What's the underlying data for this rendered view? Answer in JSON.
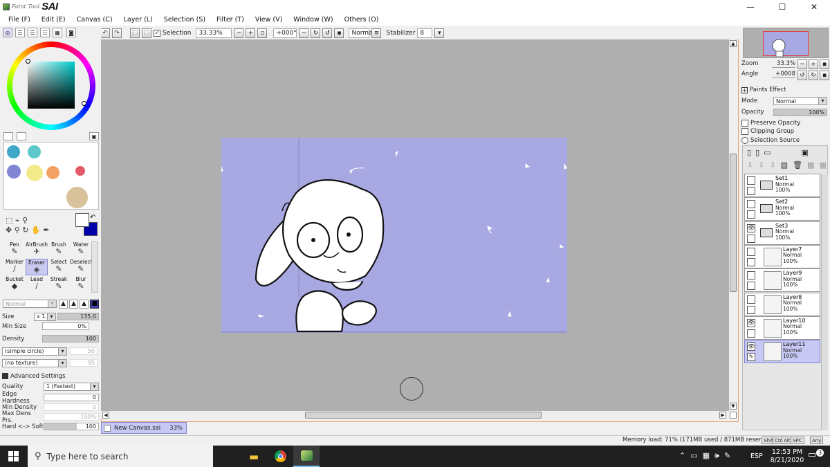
{
  "app": {
    "logo_small": "Paint Tool",
    "logo_big": "SAI"
  },
  "window_controls": {
    "minimize": "—",
    "maximize": "☐",
    "close": "✕"
  },
  "menu": [
    "File (F)",
    "Edit (E)",
    "Canvas (C)",
    "Layer (L)",
    "Selection (S)",
    "Filter (T)",
    "View (V)",
    "Window (W)",
    "Others (O)"
  ],
  "toolbar": {
    "selection_label": "Selection",
    "selection_checked": true,
    "zoom": "33.33%",
    "rotation": "+000°",
    "blend": "Normal",
    "stabilizer_label": "Stabilizer",
    "stabilizer_value": "8"
  },
  "colors": {
    "foreground": "#ffffff",
    "background": "#0000aa",
    "swatches": [
      "#3fa7c8",
      "#5cc8cc",
      "#7f85d3",
      "#f3ea8c",
      "#f3a263",
      "#e35a68",
      "#d7c29b"
    ]
  },
  "tools": [
    {
      "label": "Pen",
      "icon": "✎"
    },
    {
      "label": "AirBrush",
      "icon": "✈"
    },
    {
      "label": "Brush",
      "icon": "✎"
    },
    {
      "label": "Water",
      "icon": "✎"
    },
    {
      "label": "Marker",
      "icon": "/"
    },
    {
      "label": "Eraser",
      "icon": "◈",
      "selected": true
    },
    {
      "label": "Select",
      "icon": "✎"
    },
    {
      "label": "Deselect",
      "icon": "✎"
    },
    {
      "label": "Bucket",
      "icon": "◆"
    },
    {
      "label": "Lead",
      "icon": "/"
    },
    {
      "label": "Streak",
      "icon": "✎"
    },
    {
      "label": "Blur",
      "icon": "✎"
    }
  ],
  "brush": {
    "mode": "Normal",
    "size_label": "Size",
    "size_multiplier": "x 1.0",
    "size_value": "135.0",
    "min_size_label": "Min Size",
    "min_size_value": "0%",
    "density_label": "Density",
    "density_value": "100",
    "shape": "(simple circle)",
    "shape_value": "50",
    "texture": "(no texture)",
    "texture_value": "95",
    "advanced_label": "Advanced Settings",
    "quality_label": "Quality",
    "quality_value": "1 (Fastest)",
    "edge_hardness_label": "Edge Hardness",
    "edge_hardness_value": "0",
    "min_density_label": "Min Density",
    "min_density_value": "0",
    "max_dens_label": "Max Dens Prs.",
    "max_dens_value": "100%",
    "hard_soft_label": "Hard <-> Soft",
    "hard_soft_value": "100"
  },
  "document": {
    "tab_name": "New Canvas.sai",
    "tab_zoom": "33%"
  },
  "navigator": {
    "zoom_label": "Zoom",
    "zoom_value": "33.3%",
    "angle_label": "Angle",
    "angle_value": "+0008"
  },
  "layer_props": {
    "paints_effect": "Paints Effect",
    "mode_label": "Mode",
    "mode_value": "Normal",
    "opacity_label": "Opacity",
    "opacity_value": "100%",
    "preserve_opacity": "Preserve Opacity",
    "clipping_group": "Clipping Group",
    "selection_source": "Selection Source"
  },
  "layers": [
    {
      "name": "Set1",
      "mode": "Normal",
      "opacity": "100%",
      "type": "folder",
      "visible": false,
      "selected": false
    },
    {
      "name": "Set2",
      "mode": "Normal",
      "opacity": "100%",
      "type": "folder",
      "visible": false,
      "selected": false
    },
    {
      "name": "Set3",
      "mode": "Normal",
      "opacity": "100%",
      "type": "folder",
      "visible": true,
      "selected": false
    },
    {
      "name": "Layer7",
      "mode": "Normal",
      "opacity": "100%",
      "type": "layer",
      "visible": false,
      "selected": false
    },
    {
      "name": "Layer9",
      "mode": "Normal",
      "opacity": "100%",
      "type": "layer",
      "visible": false,
      "selected": false
    },
    {
      "name": "Layer8",
      "mode": "Normal",
      "opacity": "100%",
      "type": "layer",
      "visible": false,
      "selected": false
    },
    {
      "name": "Layer10",
      "mode": "Normal",
      "opacity": "100%",
      "type": "layer",
      "visible": true,
      "selected": false
    },
    {
      "name": "Layer11",
      "mode": "Normal",
      "opacity": "100%",
      "type": "layer",
      "visible": true,
      "selected": true
    }
  ],
  "status": {
    "memory": "Memory load: 71% (171MB used / 871MB reserved)",
    "keys": [
      "Shift",
      "Ctrl",
      "Alt",
      "SPC",
      "Any"
    ]
  },
  "taskbar": {
    "search_placeholder": "Type here to search",
    "language": "ESP",
    "time": "12:53 PM",
    "date": "8/21/2020",
    "notifications": "3"
  }
}
